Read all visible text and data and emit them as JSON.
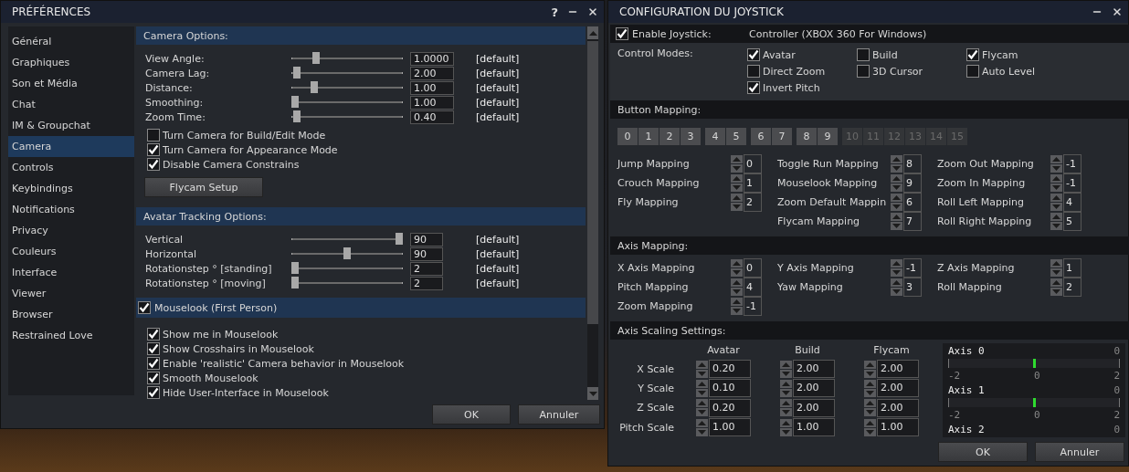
{
  "preferences": {
    "title": "PRÉFÉRENCES",
    "help": "?",
    "sidebar": [
      {
        "label": "Général",
        "selected": false
      },
      {
        "label": "Graphiques",
        "selected": false
      },
      {
        "label": "Son et Média",
        "selected": false
      },
      {
        "label": "Chat",
        "selected": false
      },
      {
        "label": "IM & Groupchat",
        "selected": false
      },
      {
        "label": "Camera",
        "selected": true
      },
      {
        "label": "Controls",
        "selected": false
      },
      {
        "label": "Keybindings",
        "selected": false
      },
      {
        "label": "Notifications",
        "selected": false
      },
      {
        "label": "Privacy",
        "selected": false
      },
      {
        "label": "Couleurs",
        "selected": false
      },
      {
        "label": "Interface",
        "selected": false
      },
      {
        "label": "Viewer",
        "selected": false
      },
      {
        "label": "Browser",
        "selected": false
      },
      {
        "label": "Restrained Love",
        "selected": false
      }
    ],
    "camera_options": {
      "title": "Camera Options:",
      "sliders": [
        {
          "label": "View Angle:",
          "level": 0.2,
          "value": "1.0000",
          "reset": "[default]"
        },
        {
          "label": "Camera Lag:",
          "level": 0.02,
          "value": "2.00",
          "reset": "[default]"
        },
        {
          "label": "Distance:",
          "level": 0.18,
          "value": "1.00",
          "reset": "[default]"
        },
        {
          "label": "Smoothing:",
          "level": 0,
          "value": "1.00",
          "reset": "[default]"
        },
        {
          "label": "Zoom Time:",
          "level": 0.02,
          "value": "0.40",
          "reset": "[default]"
        }
      ],
      "checkboxes": [
        {
          "label": "Turn Camera for Build/Edit Mode",
          "checked": false
        },
        {
          "label": "Turn Camera for Appearance Mode",
          "checked": true
        },
        {
          "label": "Disable Camera Constrains",
          "checked": true
        }
      ],
      "button": "Flycam Setup"
    },
    "avatar_tracking": {
      "title": "Avatar Tracking Options:",
      "sliders": [
        {
          "label": "Vertical",
          "level": 1,
          "value": "90",
          "reset": "[default]"
        },
        {
          "label": "Horizontal",
          "level": 0.5,
          "value": "90",
          "reset": "[default]"
        },
        {
          "label": "Rotationstep ° [standing]",
          "level": 0,
          "value": "2",
          "reset": "[default]"
        },
        {
          "label": "Rotationstep ° [moving]",
          "level": 0,
          "value": "2",
          "reset": "[default]"
        }
      ]
    },
    "mouselook": {
      "title": "Mouselook (First Person)",
      "checked": true,
      "checkboxes": [
        {
          "label": "Show me in Mouselook",
          "checked": true
        },
        {
          "label": "Show Crosshairs in Mouselook",
          "checked": true
        },
        {
          "label": "Enable 'realistic' Camera behavior in Mouselook",
          "checked": true
        },
        {
          "label": "Smooth Mouselook",
          "checked": true
        },
        {
          "label": "Hide User-Interface in Mouselook",
          "checked": true
        }
      ]
    },
    "buttons": [
      "OK",
      "Annuler"
    ]
  },
  "joystick": {
    "title": "CONFIGURATION DU JOYSTICK",
    "enable": {
      "label": "Enable Joystick:",
      "checked": true
    },
    "controller": "Controller (XBOX 360 For Windows)",
    "control_modes": {
      "label": "Control Modes:",
      "options": [
        {
          "label": "Avatar",
          "checked": true
        },
        {
          "label": "Build",
          "checked": false
        },
        {
          "label": "Flycam",
          "checked": true
        },
        {
          "label": "Direct Zoom",
          "checked": false
        },
        {
          "label": "3D Cursor",
          "checked": false
        },
        {
          "label": "Auto Level",
          "checked": false
        },
        {
          "label": "Invert Pitch",
          "checked": true
        }
      ]
    },
    "button_mapping": {
      "title": "Button Mapping:",
      "button_groups": [
        [
          {
            "label": "0",
            "disabled": false
          },
          {
            "label": "1",
            "disabled": false
          },
          {
            "label": "2",
            "disabled": false
          },
          {
            "label": "3",
            "disabled": false
          }
        ],
        [
          {
            "label": "4",
            "disabled": false
          },
          {
            "label": "5",
            "disabled": false
          }
        ],
        [
          {
            "label": "6",
            "disabled": false
          },
          {
            "label": "7",
            "disabled": false
          }
        ],
        [
          {
            "label": "8",
            "disabled": false
          },
          {
            "label": "9",
            "disabled": false
          }
        ],
        [
          {
            "label": "10",
            "disabled": true
          },
          {
            "label": "11",
            "disabled": true
          },
          {
            "label": "12",
            "disabled": true
          },
          {
            "label": "13",
            "disabled": true
          },
          {
            "label": "14",
            "disabled": true
          },
          {
            "label": "15",
            "disabled": true
          }
        ]
      ],
      "columns": [
        [
          {
            "label": "Jump Mapping",
            "value": "0"
          },
          {
            "label": "Crouch Mapping",
            "value": "1"
          },
          {
            "label": "Fly Mapping",
            "value": "2"
          }
        ],
        [
          {
            "label": "Toggle Run Mapping",
            "value": "8"
          },
          {
            "label": "Mouselook Mapping",
            "value": "9"
          },
          {
            "label": "Zoom Default Mappin",
            "value": "6"
          },
          {
            "label": "Flycam Mapping",
            "value": "7"
          }
        ],
        [
          {
            "label": "Zoom Out Mapping",
            "value": "-1"
          },
          {
            "label": "Zoom In Mapping",
            "value": "-1"
          },
          {
            "label": "Roll Left Mapping",
            "value": "4"
          },
          {
            "label": "Roll Right Mapping",
            "value": "5"
          }
        ]
      ]
    },
    "axis_mapping": {
      "title": "Axis Mapping:",
      "columns": [
        [
          {
            "label": "X Axis Mapping",
            "value": "0"
          },
          {
            "label": "Pitch Mapping",
            "value": "4"
          },
          {
            "label": "Zoom Mapping",
            "value": "-1"
          }
        ],
        [
          {
            "label": "Y Axis Mapping",
            "value": "-1"
          },
          {
            "label": "Yaw Mapping",
            "value": "3"
          }
        ],
        [
          {
            "label": "Z Axis Mapping",
            "value": "1"
          },
          {
            "label": "Roll Mapping",
            "value": "2"
          }
        ]
      ]
    },
    "axis_scaling": {
      "title": "Axis Scaling Settings:",
      "columns": [
        "Avatar",
        "Build",
        "Flycam"
      ],
      "rows": [
        {
          "label": "X Scale",
          "values": [
            "0.20",
            "2.00",
            "2.00"
          ]
        },
        {
          "label": "Y Scale",
          "values": [
            "0.10",
            "2.00",
            "2.00"
          ]
        },
        {
          "label": "Z Scale",
          "values": [
            "0.20",
            "2.00",
            "2.00"
          ]
        },
        {
          "label": "Pitch Scale",
          "values": [
            "1.00",
            "1.00",
            "1.00"
          ]
        }
      ],
      "axes": [
        {
          "name": "Axis 0",
          "reading": "0",
          "level": 0.5,
          "min": "-2",
          "mid": "0",
          "max": "2"
        },
        {
          "name": "Axis 1",
          "reading": "0",
          "level": 0.5,
          "min": "-2",
          "mid": "0",
          "max": "2"
        },
        {
          "name": "Axis 2",
          "reading": "0"
        }
      ]
    },
    "buttons": [
      "OK",
      "Annuler"
    ]
  }
}
